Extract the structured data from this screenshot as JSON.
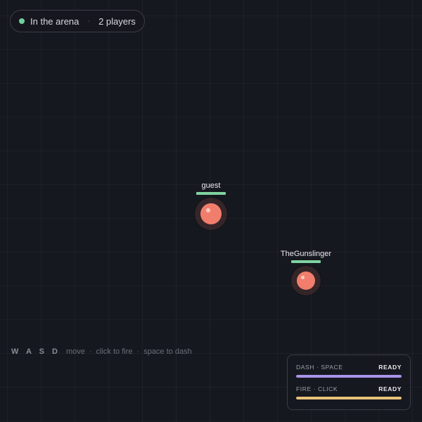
{
  "status": {
    "location": "In the arena",
    "separator": "·",
    "players": "2 players",
    "dot_color": "#6fd19a"
  },
  "players": [
    {
      "name": "guest",
      "health": 1.0,
      "color": "#f17e6c"
    },
    {
      "name": "TheGunslinger",
      "health": 1.0,
      "color": "#f17e6c"
    }
  ],
  "controls": {
    "keys": "W A S D",
    "move": "move",
    "fire": "click to fire",
    "dash": "space to dash",
    "separator": "·"
  },
  "abilities": [
    {
      "label": "DASH · SPACE",
      "state": "READY",
      "charge": 1.0,
      "color": "#a993ea"
    },
    {
      "label": "FIRE · CLICK",
      "state": "READY",
      "charge": 1.0,
      "color": "#e6c27a"
    }
  ]
}
